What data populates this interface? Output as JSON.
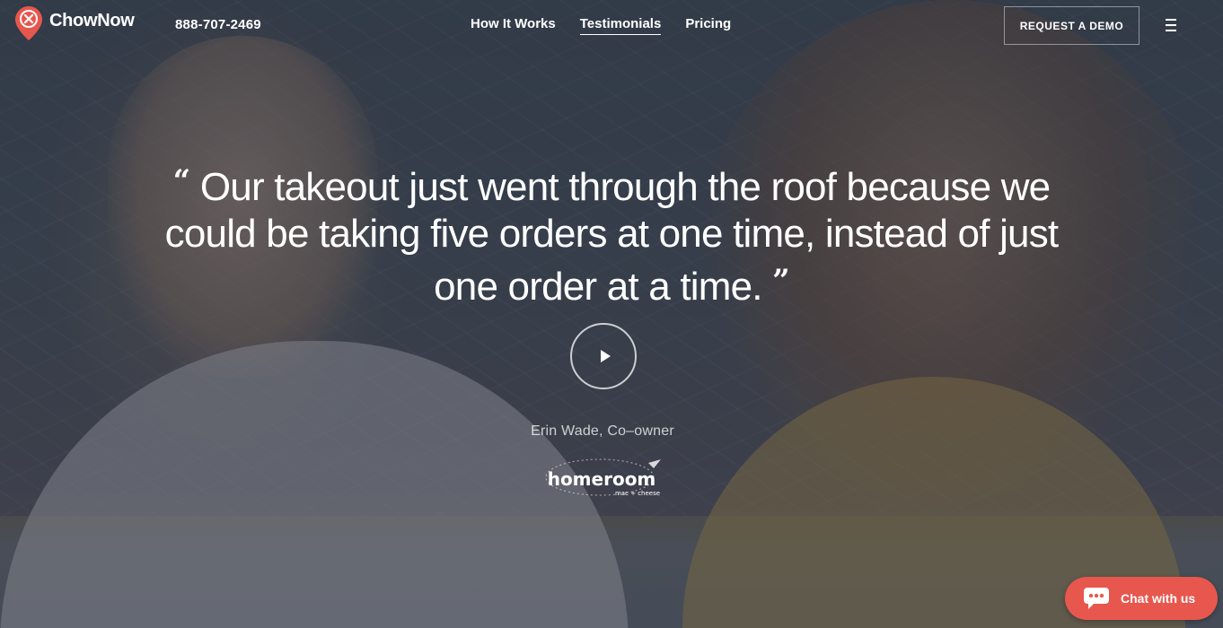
{
  "header": {
    "brand": "ChowNow",
    "phone": "888-707-2469",
    "nav": [
      {
        "label": "How It Works",
        "active": false
      },
      {
        "label": "Testimonials",
        "active": true
      },
      {
        "label": "Pricing",
        "active": false
      }
    ],
    "cta_label": "REQUEST A DEMO",
    "menu_icon": "hamburger-menu-icon"
  },
  "hero": {
    "quote_open": "“",
    "quote_text": "Our takeout just went through the roof because we could be taking five orders at one time, instead of just one order at a time.",
    "quote_close": "”",
    "play_icon": "play-icon",
    "attribution": "Erin Wade, Co–owner",
    "brand_logo_text": "homeroom",
    "brand_logo_subtext": "mac + cheese"
  },
  "chat": {
    "label": "Chat with us",
    "icon": "chat-bubble-icon"
  },
  "colors": {
    "accent": "#e8574d",
    "overlay": "#282e3c"
  }
}
